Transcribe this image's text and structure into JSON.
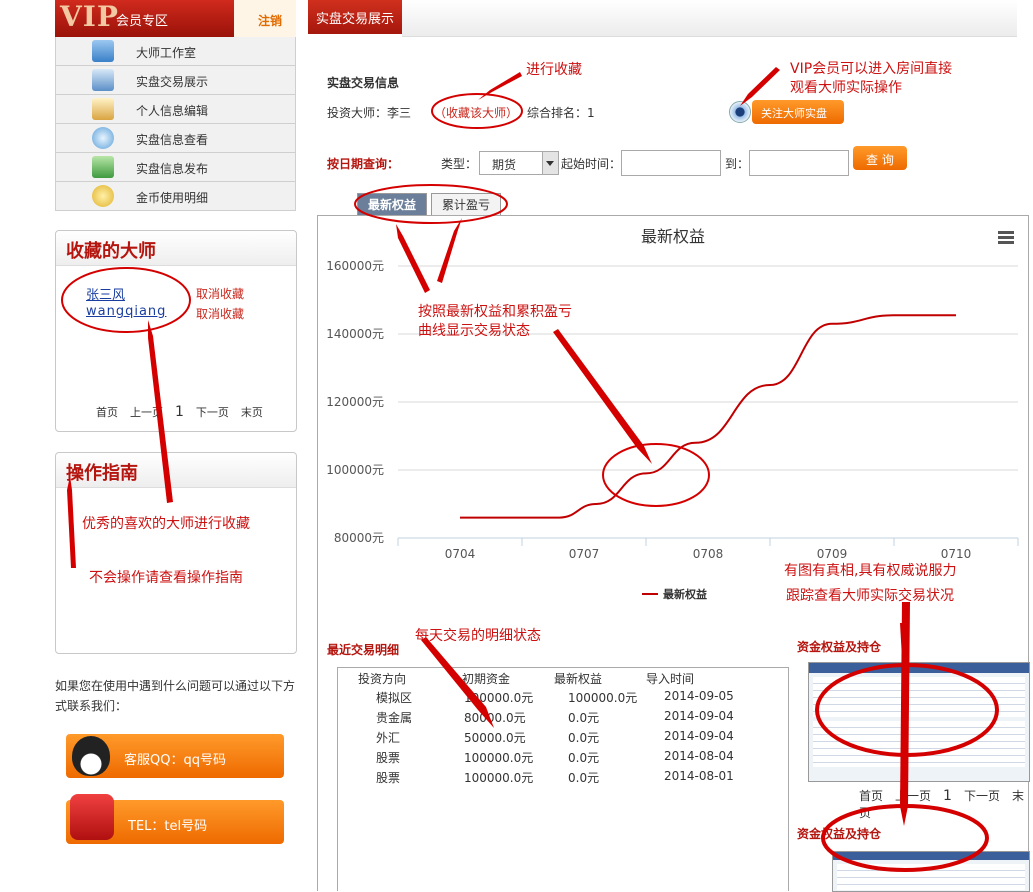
{
  "vip": {
    "logo": "VIP",
    "title": "会员专区",
    "logout": "注销"
  },
  "menu": [
    {
      "label": "大师工作室",
      "icon": "house-icon",
      "color": "#4a90d9"
    },
    {
      "label": "实盘交易展示",
      "icon": "chart-icon",
      "color": "#5b8fc7"
    },
    {
      "label": "个人信息编辑",
      "icon": "edit-icon",
      "color": "#d9a441"
    },
    {
      "label": "实盘信息查看",
      "icon": "magnifier-icon",
      "color": "#5aa0d8"
    },
    {
      "label": "实盘信息发布",
      "icon": "upload-icon",
      "color": "#3f9a3f"
    },
    {
      "label": "金币使用明细",
      "icon": "coins-icon",
      "color": "#e0b22a"
    }
  ],
  "favorites": {
    "title": "收藏的大师",
    "items": [
      {
        "name": "张三风",
        "action": "取消收藏"
      },
      {
        "name": "wangqiang",
        "action": "取消收藏"
      }
    ],
    "pager": {
      "first": "首页",
      "prev": "上一页",
      "current": "1",
      "next": "下一页",
      "last": "末页"
    }
  },
  "guide": {
    "title": "操作指南"
  },
  "contact": {
    "text": "如果您在使用中遇到什么问题可以通过以下方式联系我们：",
    "qq": "客服QQ：qq号码",
    "tel": "TEL：tel号码"
  },
  "header": {
    "tab": "实盘交易展示"
  },
  "info": {
    "section": "实盘交易信息",
    "master_label": "投资大师：李三",
    "fav_link": "（收藏该大师）",
    "rank": "综合排名：1",
    "follow_btn": "关注大师实盘"
  },
  "query": {
    "label": "按日期查询：",
    "type_label": "类型：",
    "type_value": "期货",
    "start_label": "起始时间：",
    "to_label": "到：",
    "start_value": "",
    "end_value": "",
    "button": "查 询"
  },
  "tabs": [
    "最新权益",
    "累计盈亏"
  ],
  "chart_data": {
    "type": "line",
    "title": "最新权益",
    "categories": [
      "0704",
      "0707",
      "0708",
      "0709",
      "0710"
    ],
    "series": [
      {
        "name": "最新权益",
        "color": "#c00000",
        "x": [
          0.0,
          0.25,
          0.8,
          1.1,
          1.5,
          1.9,
          2.5,
          3.0,
          3.5,
          4.0
        ],
        "values": [
          86000,
          86000,
          86000,
          90000,
          99000,
          108000,
          125000,
          143000,
          145500,
          145500
        ]
      }
    ],
    "ylim": [
      80000,
      160000
    ],
    "yticks": [
      "80000元",
      "100000元",
      "120000元",
      "140000元",
      "160000元"
    ],
    "grid": true,
    "legend": "bottom"
  },
  "annotations": {
    "fav": "进行收藏",
    "vip_line1": "VIP会员可以进入房间直接",
    "vip_line2": "观看大师实际操作",
    "curve_line1": "按照最新权益和累积盈亏",
    "curve_line2": "曲线显示交易状态",
    "daily": "每天交易的明细状态",
    "proof_line1": "有图有真相,具有权威说服力",
    "proof_line2": "跟踪查看大师实际交易状况",
    "fav_master": "优秀的喜欢的大师进行收藏",
    "guide_tip": "不会操作请查看操作指南"
  },
  "trades": {
    "title": "最近交易明细",
    "headers": [
      "投资方向",
      "初期资金",
      "最新权益",
      "导入时间"
    ],
    "rows": [
      [
        "模拟区",
        "100000.0元",
        "100000.0元",
        "2014-09-05"
      ],
      [
        "贵金属",
        "80000.0元",
        "0.0元",
        "2014-09-04"
      ],
      [
        "外汇",
        "50000.0元",
        "0.0元",
        "2014-09-04"
      ],
      [
        "股票",
        "100000.0元",
        "0.0元",
        "2014-08-04"
      ],
      [
        "股票",
        "100000.0元",
        "0.0元",
        "2014-08-01"
      ]
    ]
  },
  "holdings": {
    "title1": "资金权益及持仓",
    "title2": "资金权益及持仓",
    "pager": {
      "first": "首页",
      "prev": "上一页",
      "current": "1",
      "next": "下一页",
      "last": "末页"
    }
  }
}
